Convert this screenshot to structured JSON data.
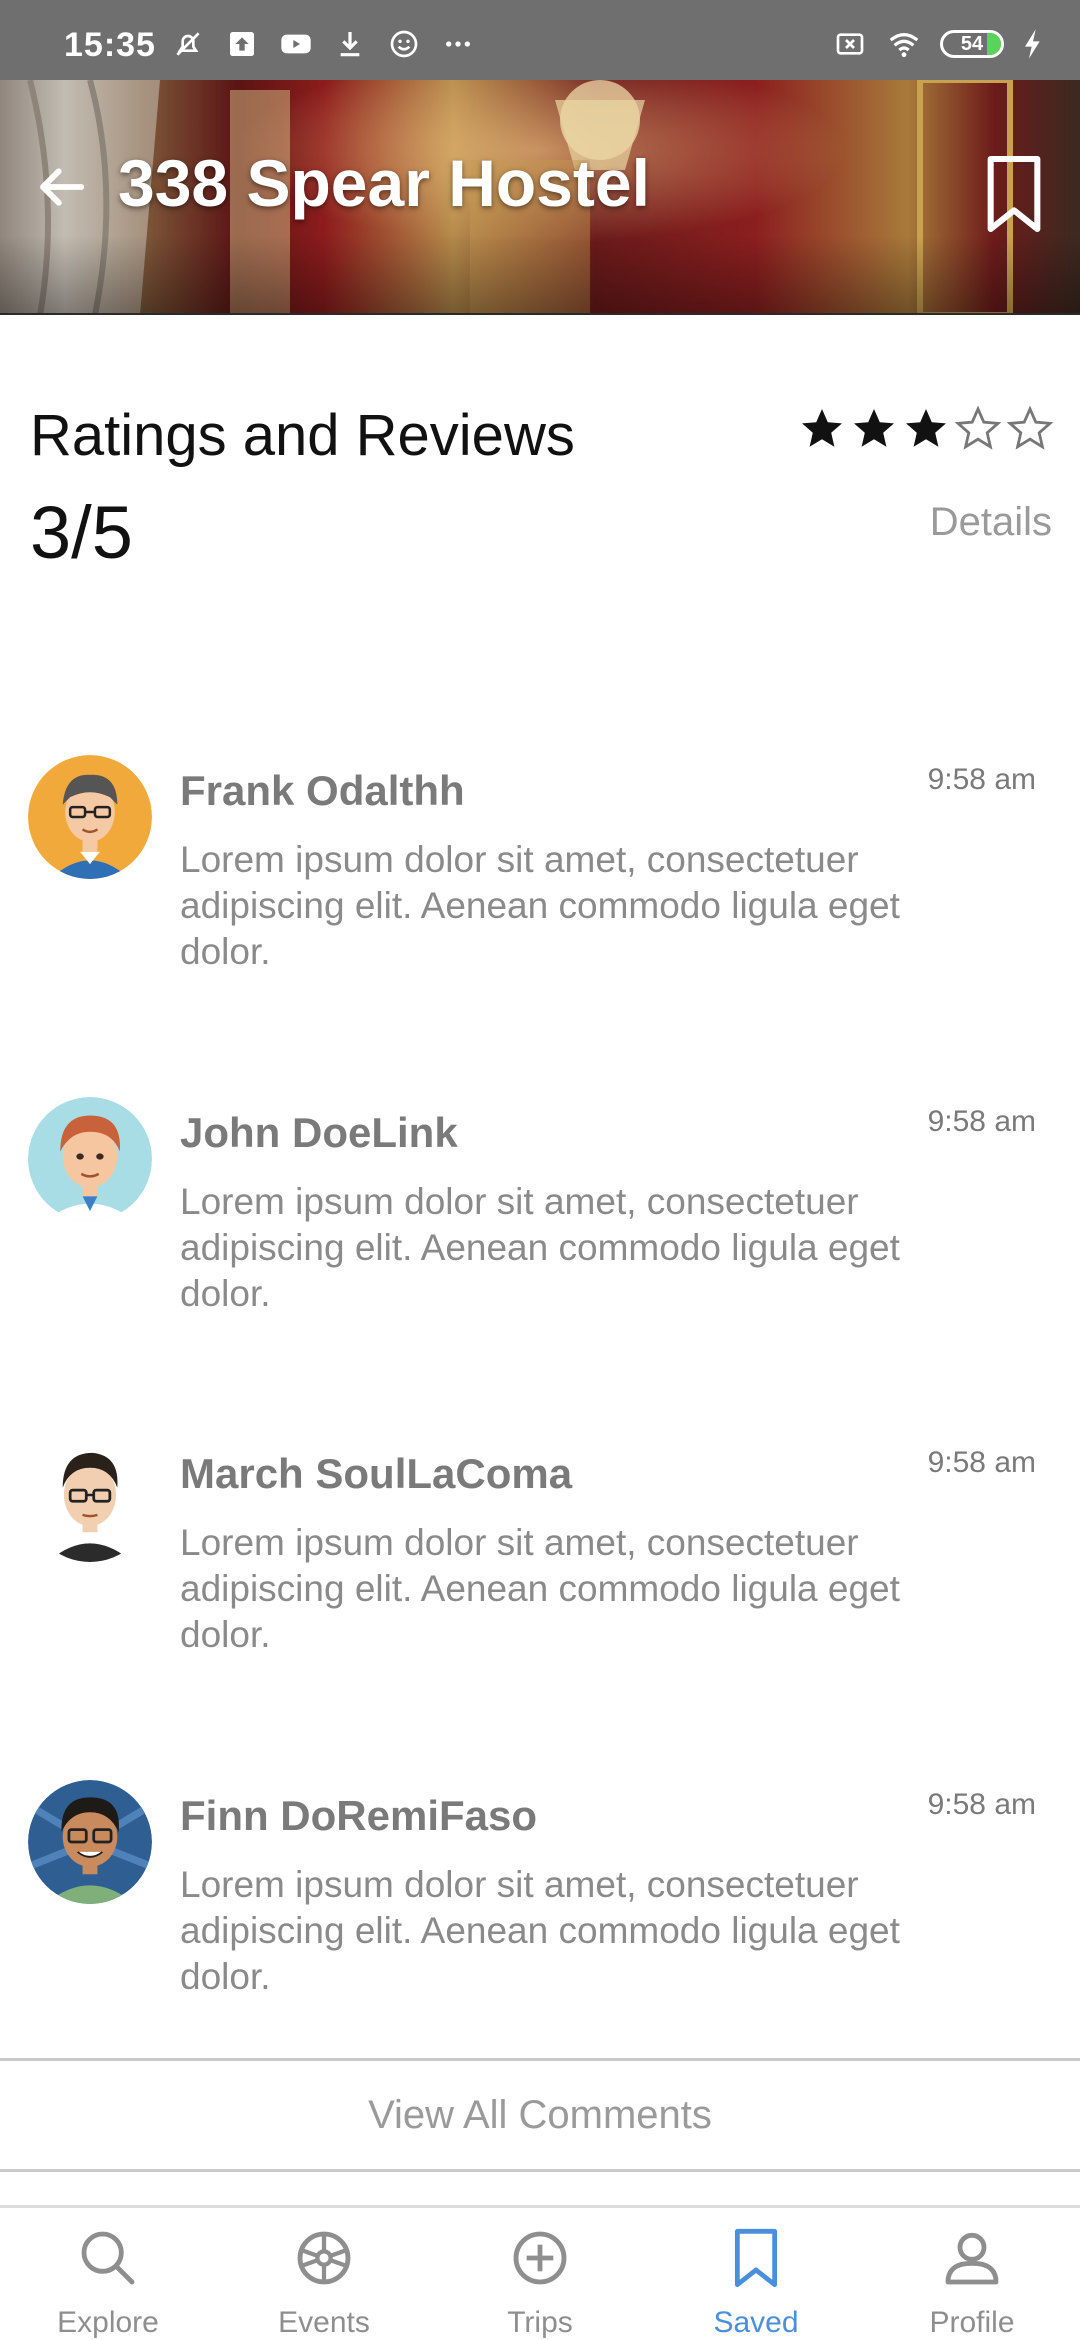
{
  "status_bar": {
    "time": "15:35",
    "battery_level": "54",
    "icons": [
      "bell-off-icon",
      "upload-icon",
      "youtube-icon",
      "download-icon",
      "smiley-icon",
      "more-icon",
      "sim-off-icon",
      "wifi-icon",
      "battery-icon",
      "charging-icon"
    ]
  },
  "header": {
    "title": "338 Spear Hostel",
    "back_icon": "arrow-left-icon",
    "bookmark_icon": "bookmark-icon"
  },
  "ratings": {
    "title": "Ratings and Reviews",
    "score": "3/5",
    "stars_filled": 3,
    "stars_total": 5,
    "details_label": "Details"
  },
  "reviews": [
    {
      "name": "Frank Odalthh",
      "time": "9:58 am",
      "text": "Lorem ipsum dolor sit amet, consectetuer adipiscing elit. Aenean commodo ligula eget dolor."
    },
    {
      "name": "John DoeLink",
      "time": "9:58 am",
      "text": "Lorem ipsum dolor sit amet, consectetuer adipiscing elit. Aenean commodo ligula eget dolor."
    },
    {
      "name": "March SoulLaComa",
      "time": "9:58 am",
      "text": "Lorem ipsum dolor sit amet, consectetuer adipiscing elit. Aenean commodo ligula eget dolor."
    },
    {
      "name": "Finn DoRemiFaso",
      "time": "9:58 am",
      "text": "Lorem ipsum dolor sit amet, consectetuer adipiscing elit. Aenean commodo ligula eget dolor."
    }
  ],
  "view_all_label": "View All Comments",
  "bottom_nav": {
    "items": [
      {
        "label": "Explore",
        "icon": "search-icon"
      },
      {
        "label": "Events",
        "icon": "wheel-icon"
      },
      {
        "label": "Trips",
        "icon": "plus-circle-icon"
      },
      {
        "label": "Saved",
        "icon": "bookmark-icon"
      },
      {
        "label": "Profile",
        "icon": "person-icon"
      }
    ],
    "active": "Saved"
  },
  "colors": {
    "accent": "#4a8fdc",
    "status_bar": "#6f6f6f",
    "secondary_text": "#8a8a8a"
  }
}
